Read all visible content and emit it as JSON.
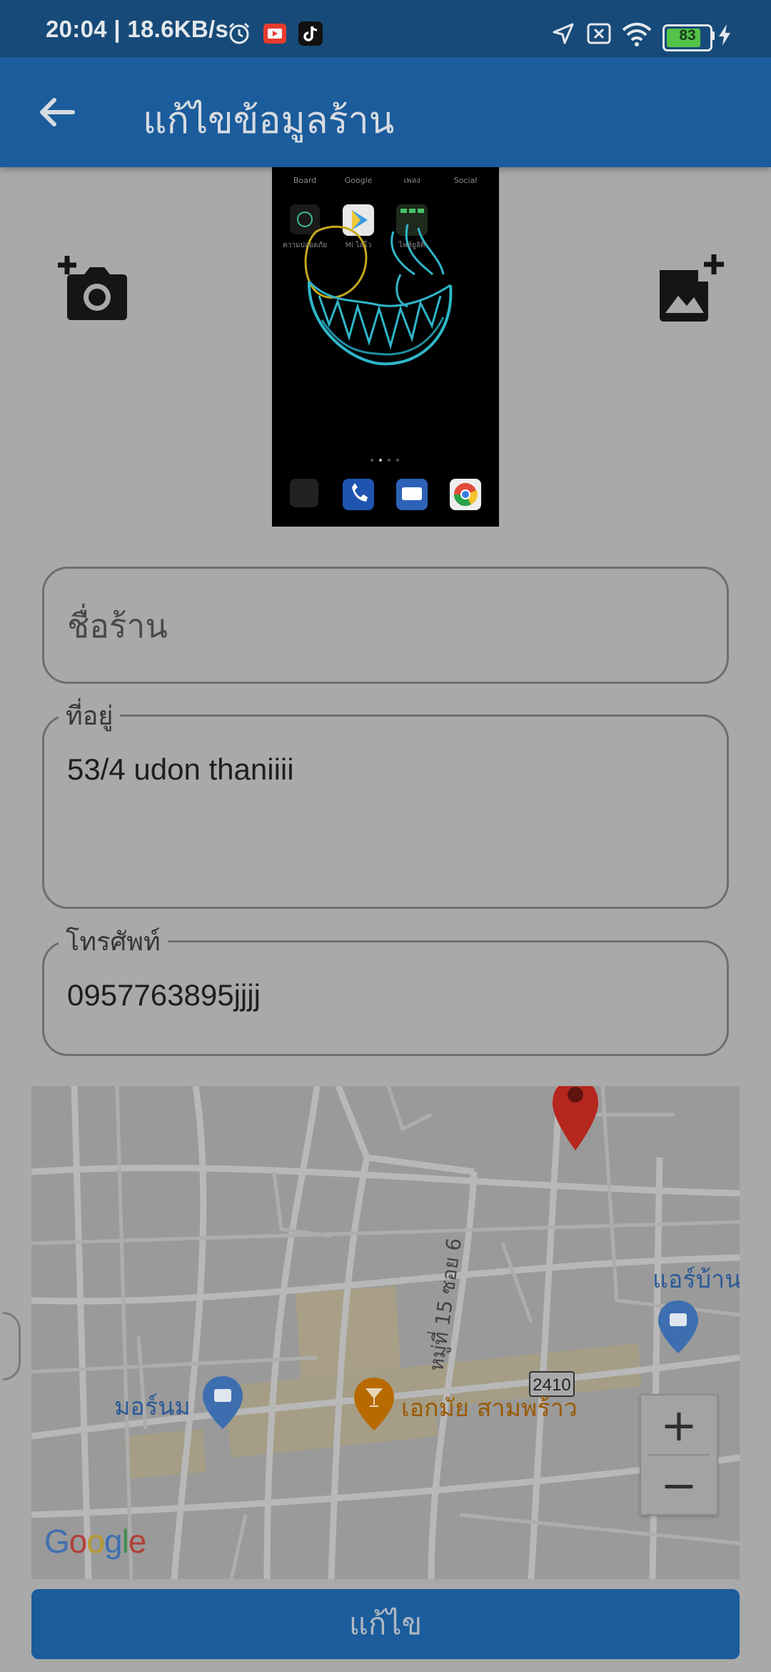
{
  "status_bar": {
    "time": "20:04 | 18.6KB/s",
    "battery": "83",
    "battery_fraction": 0.83,
    "icons": [
      "alarm-icon",
      "youtube-icon",
      "tiktok-icon",
      "location-icon",
      "sim-off-icon",
      "wifi-icon",
      "battery-icon",
      "charging-icon"
    ]
  },
  "app_bar": {
    "title": "แก้ไขข้อมูลร้าน",
    "back_icon": "arrow-back-icon"
  },
  "image_picker": {
    "camera_icon": "add-camera-icon",
    "gallery_icon": "add-photo-icon",
    "preview_labels": [
      "Board",
      "Google",
      "เพลง",
      "Social",
      "ความปลอดภัย",
      "Mi ไลโว",
      "ไฟล์ยูลิตี"
    ]
  },
  "form": {
    "shop_name": {
      "placeholder": "ชื่อร้าน",
      "value": ""
    },
    "address": {
      "label": "ที่อยู่",
      "value": "53/4 udon thaniiii"
    },
    "phone": {
      "label": "โทรศัพท์",
      "value": "0957763895jjjj"
    }
  },
  "map": {
    "street_label": "หมู่ที่ 15 ซอย 6",
    "poi_mornom": "มอร์นม",
    "poi_ekamai": "เอกมัย สามพร้าว",
    "poi_airbaan": "แอร์บ้าน",
    "route_shield": "2410",
    "zoom_in": "+",
    "zoom_out": "−",
    "attribution": "Google"
  },
  "submit": {
    "label": "แก้ไข"
  },
  "colors": {
    "app_bar": "#1b5c9c",
    "status_bar": "#174a78",
    "scrim_background": "#a9a9a9",
    "marker_red": "#b5261e",
    "poi_blue": "#3d6fb0",
    "poi_orange": "#b86a00"
  }
}
